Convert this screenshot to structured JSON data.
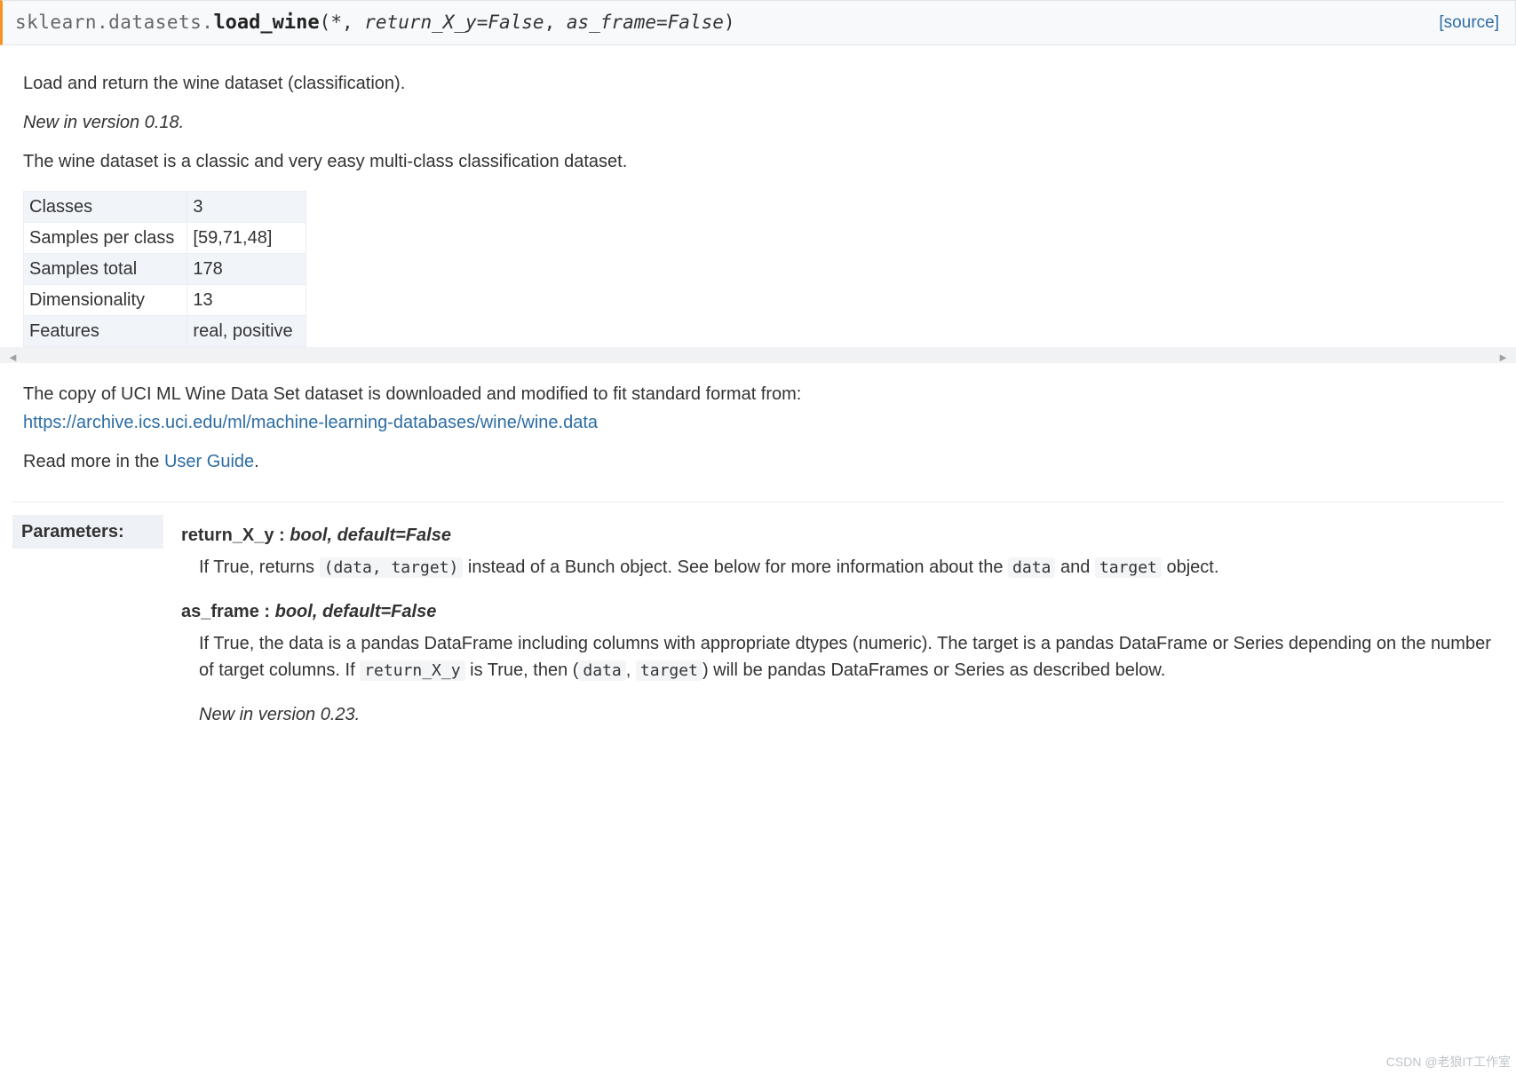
{
  "signature": {
    "module": "sklearn.datasets.",
    "func": "load_wine",
    "paren_open": "(",
    "star": "*",
    "comma1": ", ",
    "param1": "return_X_y=False",
    "comma2": ", ",
    "param2": "as_frame=False",
    "paren_close": ")",
    "source_label": "[source]"
  },
  "intro": {
    "p1": "Load and return the wine dataset (classification).",
    "versionadded": "New in version 0.18.",
    "p2": "The wine dataset is a classic and very easy multi-class classification dataset."
  },
  "table": [
    {
      "k": "Classes",
      "v": "3"
    },
    {
      "k": "Samples per class",
      "v": "[59,71,48]"
    },
    {
      "k": "Samples total",
      "v": "178"
    },
    {
      "k": "Dimensionality",
      "v": "13"
    },
    {
      "k": "Features",
      "v": "real, positive"
    }
  ],
  "after_table": {
    "line1": "The copy of UCI ML Wine Data Set dataset is downloaded and modified to fit standard format from:",
    "url": "https://archive.ics.uci.edu/ml/machine-learning-databases/wine/wine.data",
    "readmore_pre": "Read more in the ",
    "readmore_link": "User Guide",
    "readmore_post": "."
  },
  "params": {
    "label": "Parameters:",
    "p1": {
      "head_name": "return_X_y : ",
      "head_type": "bool, default=False",
      "body_pre": "If True, returns ",
      "code1": "(data, target)",
      "body_mid": " instead of a Bunch object. See below for more information about the ",
      "code2": "data",
      "body_and": " and ",
      "code3": "target",
      "body_post": " object."
    },
    "p2": {
      "head_name": "as_frame : ",
      "head_type": "bool, default=False",
      "body_pre": "If True, the data is a pandas DataFrame including columns with appropriate dtypes (numeric). The target is a pandas DataFrame or Series depending on the number of target columns. If ",
      "code1": "return_X_y",
      "body_mid": " is True, then (",
      "code2": "data",
      "body_comma": ", ",
      "code3": "target",
      "body_post": ") will be pandas DataFrames or Series as described below.",
      "version": "New in version 0.23."
    }
  },
  "watermark": "CSDN @老狼IT工作室"
}
